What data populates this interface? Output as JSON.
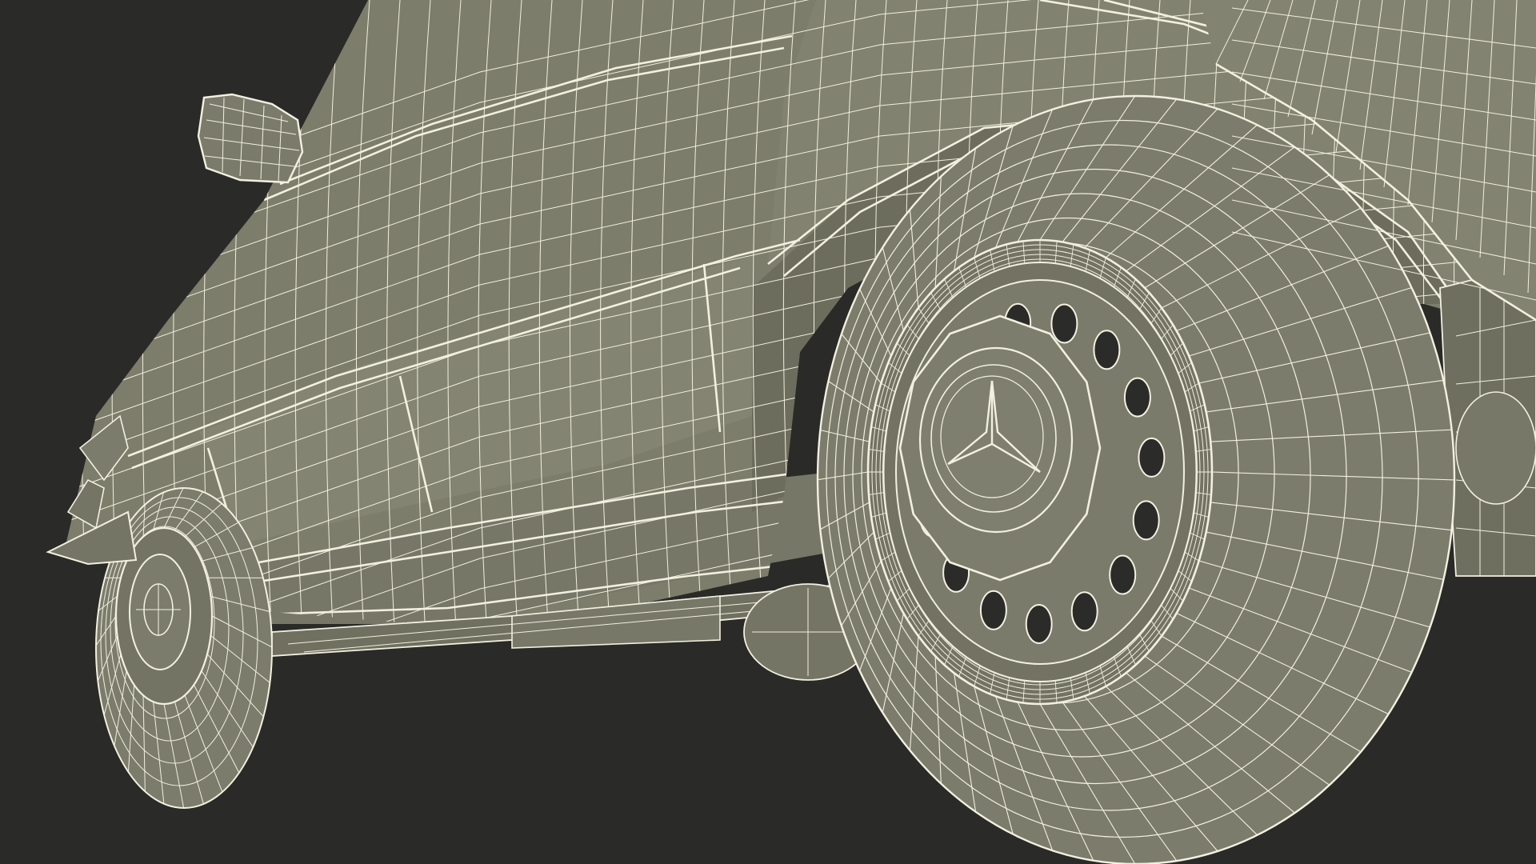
{
  "colors": {
    "background": "#2a2a28",
    "body_fill": "#7c7d6b",
    "body_fill_dark": "#6b6c5c",
    "body_fill_light": "#888978",
    "wire": "#f2f0e0",
    "hole": "#2b2b29"
  },
  "scene": {
    "subject": "wireframe-car-model"
  }
}
